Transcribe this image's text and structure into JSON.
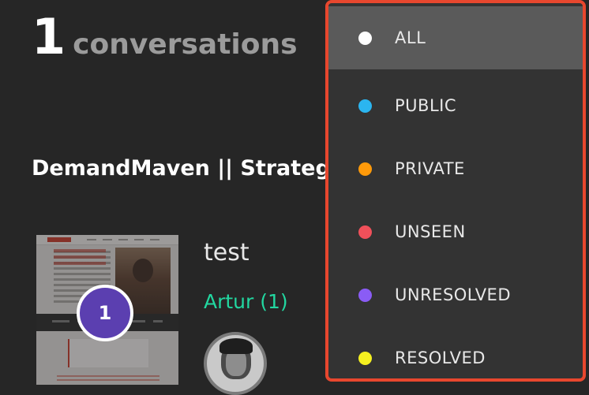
{
  "header": {
    "count": "1",
    "label": "conversations"
  },
  "project": {
    "name": "DemandMaven || Strategy"
  },
  "conversation": {
    "title": "test",
    "user": "Artur (1)",
    "badge_count": "1"
  },
  "filter_dropdown": {
    "selected": "ALL",
    "items": [
      {
        "label": "ALL",
        "color": "#ffffff",
        "icon": "dot-icon"
      },
      {
        "label": "PUBLIC",
        "color": "#2bb5f0",
        "icon": "dot-icon"
      },
      {
        "label": "PRIVATE",
        "color": "#ff9a0a",
        "icon": "dot-icon"
      },
      {
        "label": "UNSEEN",
        "color": "#f0505a",
        "icon": "dot-icon"
      },
      {
        "label": "UNRESOLVED",
        "color": "#8a5cf5",
        "icon": "dot-icon"
      },
      {
        "label": "RESOLVED",
        "color": "#f5f020",
        "icon": "dot-icon"
      }
    ]
  },
  "colors": {
    "accent_border": "#e8472e",
    "user_name": "#22d7a0",
    "badge": "#5b3fb0"
  }
}
